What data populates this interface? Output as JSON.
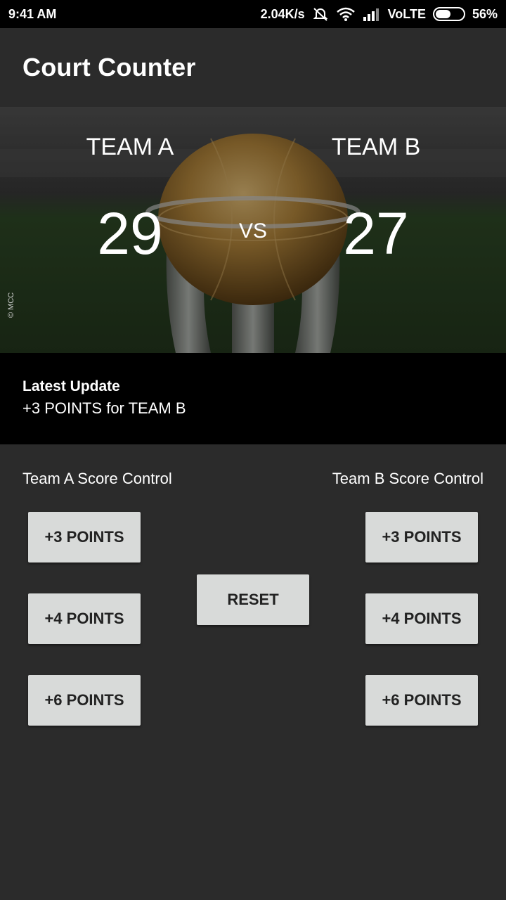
{
  "status_bar": {
    "time": "9:41 AM",
    "speed": "2.04K/s",
    "network": "VoLTE",
    "battery": "56%",
    "battery_level": 0.56
  },
  "app": {
    "title": "Court Counter"
  },
  "scoreboard": {
    "team_a": {
      "name": "TEAM A",
      "score": "29"
    },
    "team_b": {
      "name": "TEAM B",
      "score": "27"
    },
    "vs": "VS",
    "credit": "© MCC"
  },
  "update": {
    "title": "Latest Update",
    "text": "+3 POINTS for TEAM B"
  },
  "controls": {
    "team_a_label": "Team A Score Control",
    "team_b_label": "Team B Score Control",
    "team_a_buttons": [
      "+3 POINTS",
      "+4 POINTS",
      "+6 POINTS"
    ],
    "team_b_buttons": [
      "+3 POINTS",
      "+4 POINTS",
      "+6 POINTS"
    ],
    "reset": "RESET"
  },
  "colors": {
    "background": "#2b2b2b",
    "status_bar": "#000000",
    "update_panel": "#000000",
    "button": "#d8dad9",
    "button_text": "#222222"
  }
}
